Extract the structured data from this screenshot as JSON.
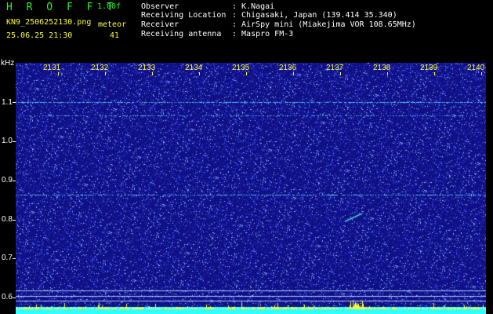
{
  "header": {
    "app_title": "H R O F F T",
    "version": "1.00f",
    "filename": "KN9_2506252130.png",
    "mode_label": "meteor",
    "count": "41",
    "datetime": "25.06.25 21:30",
    "fields": [
      {
        "label": "Observer",
        "value": ": K.Nagai"
      },
      {
        "label": "Receiving Location",
        "value": ": Chigasaki, Japan (139.414 35.340)"
      },
      {
        "label": "Receiver",
        "value": ": AirSpy mini (Miakejima VOR 108.65MHz)"
      },
      {
        "label": "Receiving antenna",
        "value": ": Maspro FM-3"
      }
    ]
  },
  "axis": {
    "unit": "kHz",
    "freq_labels": [
      "1.1",
      "1.0",
      "0.9",
      "0.8",
      "0.7",
      "0.6"
    ],
    "time_labels": [
      "2131",
      "2132",
      "2133",
      "2134",
      "2135",
      "2136",
      "2137",
      "2138",
      "2139",
      "2140"
    ]
  },
  "colors": {
    "background": "#10108c",
    "noise": "#3a3ae0",
    "carrier": "#40c0e0",
    "title_green": "#27f527",
    "label_yellow": "#ffff33",
    "baseline_cyan": "#33ffff"
  }
}
